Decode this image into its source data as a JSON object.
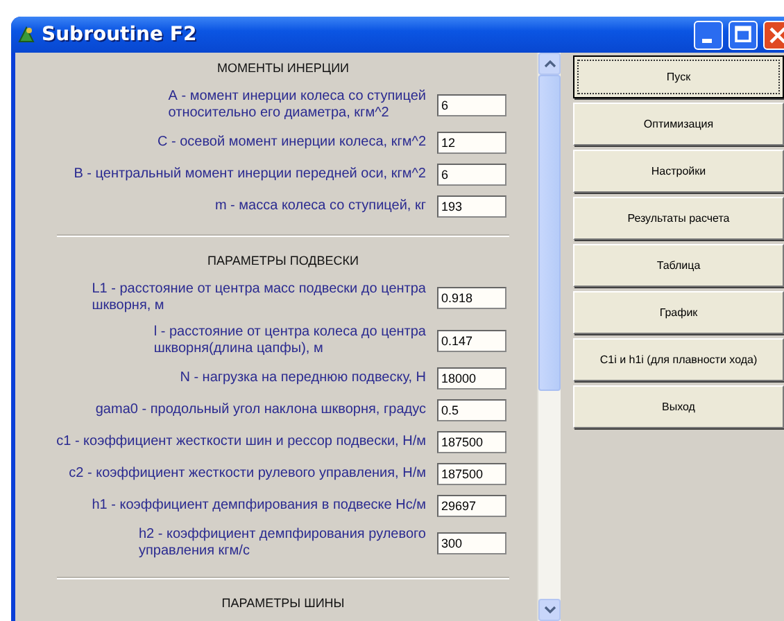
{
  "window": {
    "title": "Subroutine F2"
  },
  "sections": [
    {
      "heading": "МОМЕНТЫ ИНЕРЦИИ",
      "fields": [
        {
          "label": "А - момент инерции колеса со ступицей\nотносительно его диаметра, кгм^2",
          "value": "6"
        },
        {
          "label": "С - осевой момент инерции колеса, кгм^2",
          "value": "12"
        },
        {
          "label": "В - центральный момент инерции передней оси, кгм^2",
          "value": "6"
        },
        {
          "label": "m - масса колеса со ступицей, кг",
          "value": "193"
        }
      ]
    },
    {
      "heading": "ПАРАМЕТРЫ ПОДВЕСКИ",
      "fields": [
        {
          "label": "L1 - расстояние от центра масс подвески до центра\nшкворня, м",
          "value": "0.918"
        },
        {
          "label": "l - расстояние от центра колеса до центра\nшкворня(длина цапфы), м",
          "value": "0.147"
        },
        {
          "label": "N - нагрузка на переднюю подвеску, Н",
          "value": "18000"
        },
        {
          "label": "gama0 - продольный угол наклона шкворня, градус",
          "value": "0.5"
        },
        {
          "label": "c1 - коэффициент жесткости шин и рессор подвески, Н/м",
          "value": "187500"
        },
        {
          "label": "c2 - коэффициент жесткости рулевого управления, Н/м",
          "value": "187500"
        },
        {
          "label": "h1 - коэффициент демпфирования в подвеске Нс/м",
          "value": "29697"
        },
        {
          "label": "h2 - коэффициент демпфирования рулевого\nуправления кгм/с",
          "value": "300"
        }
      ]
    },
    {
      "heading": "ПАРАМЕТРЫ ШИНЫ"
    }
  ],
  "buttons": [
    {
      "label": "Пуск",
      "focused": true
    },
    {
      "label": "Оптимизация",
      "focused": false
    },
    {
      "label": "Настройки",
      "focused": false
    },
    {
      "label": "Результаты расчета",
      "focused": false
    },
    {
      "label": "Таблица",
      "focused": false
    },
    {
      "label": "График",
      "focused": false
    },
    {
      "label": "C1i и h1i (для плавности хода)",
      "focused": false
    },
    {
      "label": "Выход",
      "focused": false
    }
  ]
}
